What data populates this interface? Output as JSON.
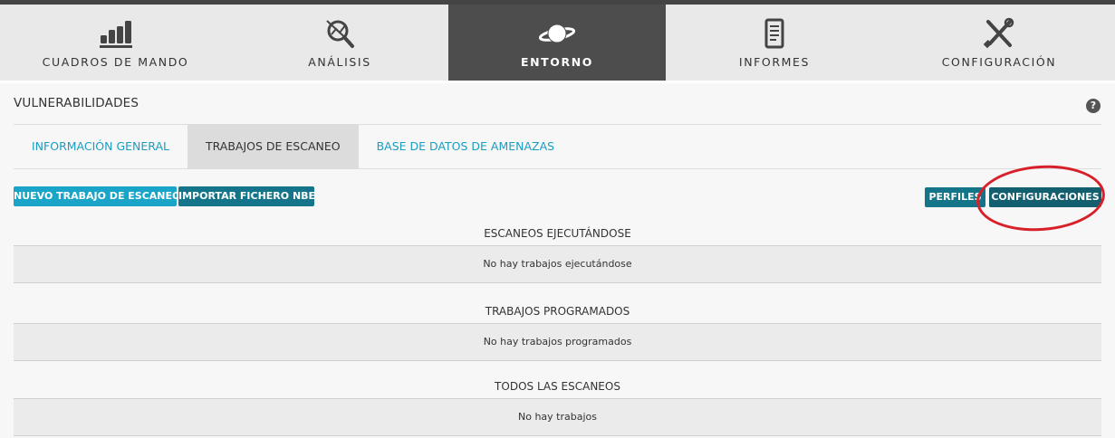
{
  "nav": {
    "items": [
      {
        "label": "CUADROS DE MANDO",
        "icon": "bar-chart-icon"
      },
      {
        "label": "ANÁLISIS",
        "icon": "magnifier-analysis-icon"
      },
      {
        "label": "ENTORNO",
        "icon": "planet-icon",
        "active": true
      },
      {
        "label": "INFORMES",
        "icon": "document-icon"
      },
      {
        "label": "CONFIGURACIÓN",
        "icon": "tools-icon"
      }
    ]
  },
  "page": {
    "title": "VULNERABILIDADES",
    "help": "?"
  },
  "tabs": [
    {
      "label": "INFORMACIÓN GENERAL"
    },
    {
      "label": "TRABAJOS DE ESCANEO",
      "active": true
    },
    {
      "label": "BASE DE DATOS DE AMENAZAS"
    }
  ],
  "buttons": {
    "new_scan": "NUEVO TRABAJO DE ESCANEO",
    "import_nbe": "IMPORTAR FICHERO NBE",
    "profiles": "PERFILES",
    "settings": "CONFIGURACIONES"
  },
  "sections": {
    "running": {
      "title": "ESCANEOS EJECUTÁNDOSE",
      "empty": "No hay trabajos ejecutándose"
    },
    "scheduled": {
      "title": "TRABAJOS PROGRAMADOS",
      "empty": "No hay trabajos programados"
    },
    "all": {
      "title": "TODOS LAS ESCANEOS",
      "empty": "No hay trabajos"
    }
  },
  "colors": {
    "nav_active": "#4d4d4d",
    "link": "#1a9dc0",
    "button_light": "#1aa5c8",
    "button_dark": "#14758a",
    "highlight": "#d8202b"
  }
}
